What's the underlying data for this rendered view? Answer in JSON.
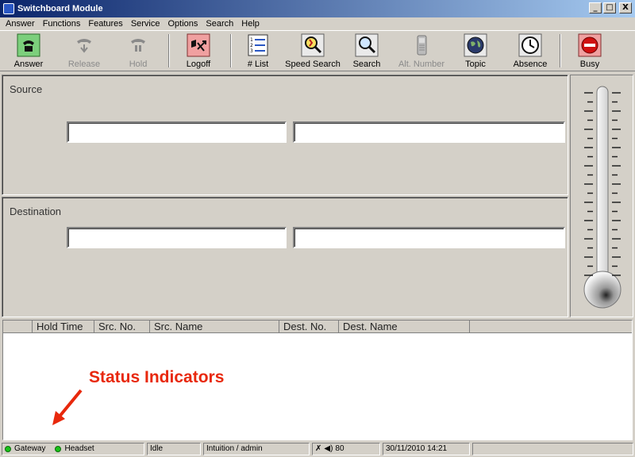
{
  "window": {
    "title": "Switchboard Module",
    "controls": [
      "_",
      "□",
      "X"
    ]
  },
  "menu": [
    "Answer",
    "Functions",
    "Features",
    "Service",
    "Options",
    "Search",
    "Help"
  ],
  "toolbar": {
    "answer": "Answer",
    "release": "Release",
    "hold": "Hold",
    "logoff": "Logoff",
    "list": "# List",
    "speed_search": "Speed Search",
    "search": "Search",
    "alt_number": "Alt. Number",
    "topic": "Topic",
    "absence": "Absence",
    "busy": "Busy"
  },
  "source": {
    "title": "Source",
    "field1": "",
    "field2": ""
  },
  "destination": {
    "title": "Destination",
    "field1": "",
    "field2": ""
  },
  "list": {
    "columns": [
      "Hold Time",
      "Src. No.",
      "Src. Name",
      "Dest. No.",
      "Dest. Name"
    ]
  },
  "annotation": "Status Indicators",
  "status": {
    "gateway": "Gateway",
    "headset": "Headset",
    "state": "Idle",
    "user": "Intuition / admin",
    "volume": "80",
    "datetime": "30/11/2010 14:21"
  },
  "colors": {
    "accent": "#e8280c",
    "led": "#19c219",
    "titlebar": "#0a246a"
  }
}
